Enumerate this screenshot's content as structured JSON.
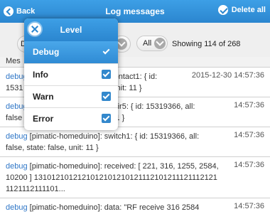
{
  "header": {
    "back_label": "Back",
    "title": "Log messages",
    "delete_label": "Delete all"
  },
  "filters": {
    "first_select_partial": "D",
    "all_select": "All",
    "showing": "Showing 114 of 268"
  },
  "list_header_partial": "Mes",
  "entries": [
    {
      "level": "debug",
      "text_before": " ",
      "text_visible": "ontact1: { id:",
      "text_line2": "1531",
      "text_line2b": "true, unit: 11 }",
      "datetime": "2015-12-30 14:57:36"
    },
    {
      "level": "debug",
      "text_visible": "ir5: { id: 15319366, all:",
      "text_line2": "false",
      "text_line2b": "unit: 11 }",
      "datetime": "14:57:36"
    },
    {
      "level": "debug",
      "text": " [pimatic-homeduino]: switch1: { id: 15319366, all: false, state: false, unit: 11 }",
      "datetime": "14:57:36"
    },
    {
      "level": "debug",
      "text": " [pimatic-homeduino]: received: [ 221, 316, 1255, 2584, 10200 ] 13101210121210121012101211121012111211121211121112111101...",
      "datetime": "14:57:36"
    },
    {
      "level": "debug",
      "text": " [pimatic-homeduino]: data: \"RF receive 316 2584",
      "datetime": "14:57:36"
    }
  ],
  "level_popup": {
    "title": "Level",
    "options": [
      {
        "label": "Debug",
        "checked": true,
        "selected": true
      },
      {
        "label": "Info",
        "checked": true,
        "selected": false
      },
      {
        "label": "Warn",
        "checked": true,
        "selected": false
      },
      {
        "label": "Error",
        "checked": true,
        "selected": false
      }
    ]
  }
}
